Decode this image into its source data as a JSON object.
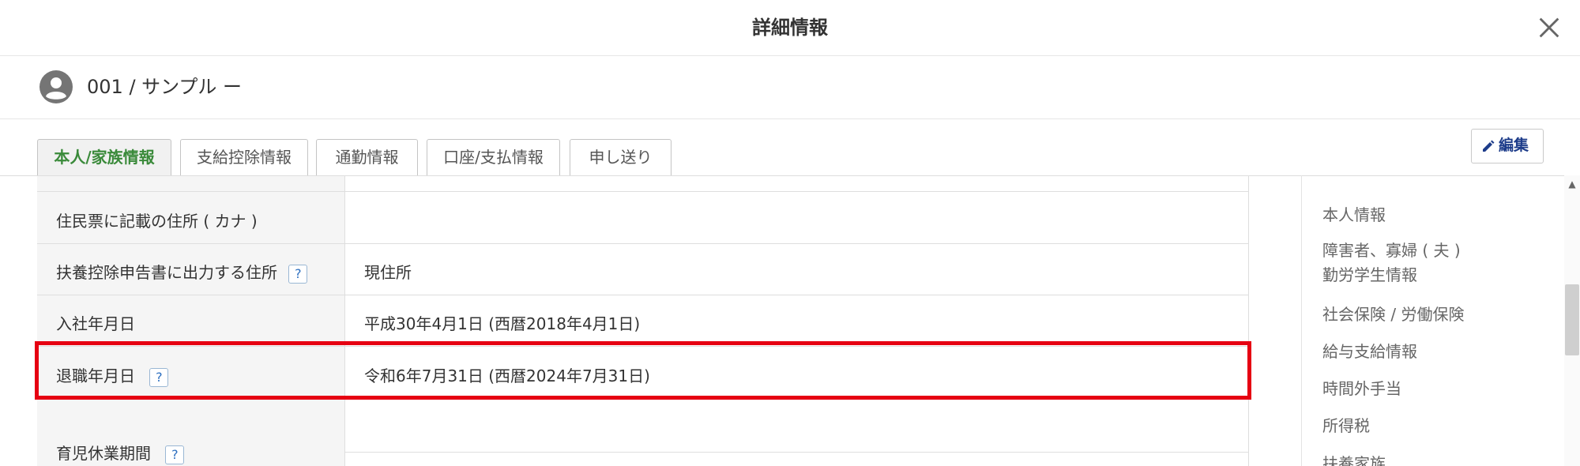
{
  "dialog": {
    "title": "詳細情報",
    "close_icon": "close-icon"
  },
  "employee": {
    "label": "001 / サンプル ー",
    "avatar_icon": "user-avatar-icon"
  },
  "tabs": [
    {
      "label": "本人/家族情報",
      "active": true
    },
    {
      "label": "支給控除情報",
      "active": false
    },
    {
      "label": "通勤情報",
      "active": false
    },
    {
      "label": "口座/支払情報",
      "active": false
    },
    {
      "label": "申し送り",
      "active": false
    }
  ],
  "edit_button": {
    "label": "編集",
    "icon": "pencil-icon"
  },
  "rows": [
    {
      "label": "住民票に記載の住所 ( カナ )",
      "value": "",
      "help": false
    },
    {
      "label": "扶養控除申告書に出力する住所",
      "value": "現住所",
      "help": true
    },
    {
      "label": "入社年月日",
      "value": "平成30年4月1日 (西暦2018年4月1日)",
      "help": false
    },
    {
      "label": "退職年月日",
      "value": "令和6年7月31日 (西暦2024年7月31日)",
      "help": true,
      "highlighted": true
    },
    {
      "label": "育児休業期間",
      "value": "",
      "help": true
    }
  ],
  "help_mark": "?",
  "sidebar": {
    "items": [
      {
        "label": "本人情報"
      },
      {
        "label": "障害者、寡婦 ( 夫 )"
      },
      {
        "label": "勤労学生情報"
      },
      {
        "label": "社会保険 / 労働保険"
      },
      {
        "label": "給与支給情報"
      },
      {
        "label": "時間外手当"
      },
      {
        "label": "所得税"
      },
      {
        "label": "扶養家族"
      }
    ]
  },
  "colors": {
    "active_tab_text": "#3a8a3a",
    "highlight_border": "#e60012",
    "edit_text": "#1d3c8a"
  }
}
